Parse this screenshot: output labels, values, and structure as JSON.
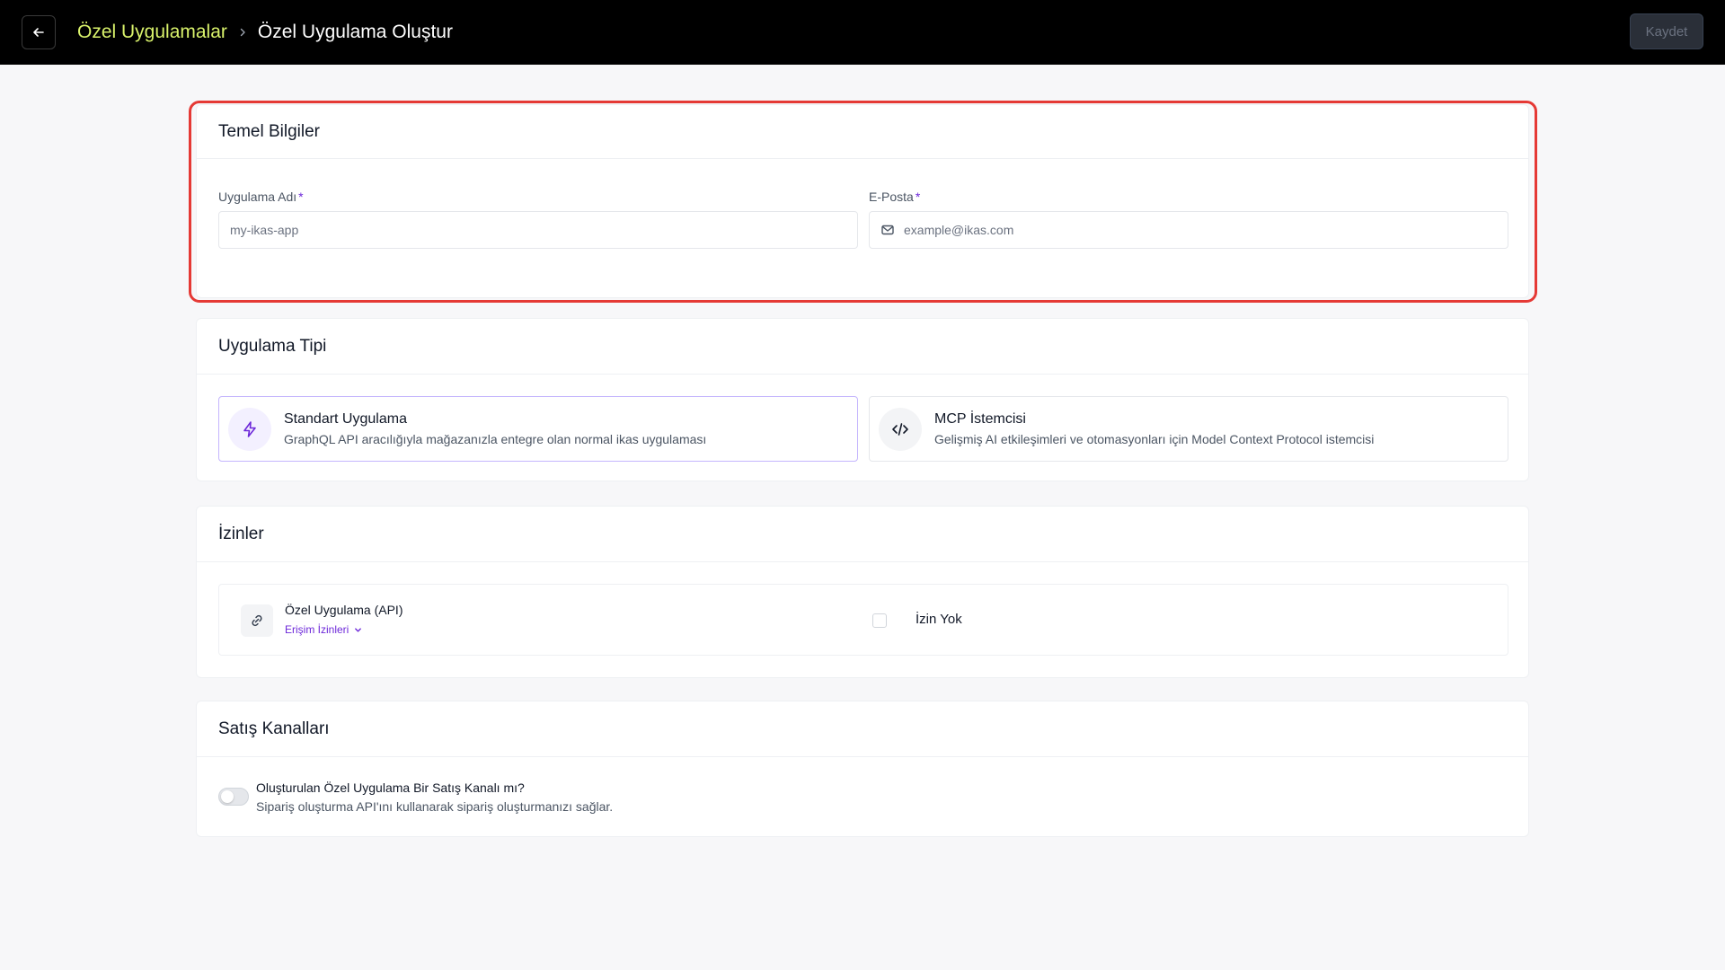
{
  "header": {
    "breadcrumb_parent": "Özel Uygulamalar",
    "breadcrumb_current": "Özel Uygulama Oluştur",
    "save_label": "Kaydet"
  },
  "basic_info": {
    "title": "Temel Bilgiler",
    "app_name_label": "Uygulama Adı",
    "app_name_placeholder": "my-ikas-app",
    "email_label": "E-Posta",
    "email_placeholder": "example@ikas.com",
    "required_mark": "*"
  },
  "app_type": {
    "title": "Uygulama Tipi",
    "options": [
      {
        "title": "Standart Uygulama",
        "description": "GraphQL API aracılığıyla mağazanızla entegre olan normal ikas uygulaması",
        "icon": "lightning-icon",
        "selected": true
      },
      {
        "title": "MCP İstemcisi",
        "description": "Gelişmiş AI etkileşimleri ve otomasyonları için Model Context Protocol istemcisi",
        "icon": "code-icon",
        "selected": false
      }
    ]
  },
  "permissions": {
    "title": "İzinler",
    "item_title": "Özel Uygulama (API)",
    "item_link": "Erişim İzinleri",
    "no_permission_label": "İzin Yok",
    "checked": false
  },
  "sales_channels": {
    "title": "Satış Kanalları",
    "toggle_title": "Oluşturulan Özel Uygulama Bir Satış Kanalı mı?",
    "toggle_description": "Sipariş oluşturma API'ını kullanarak sipariş oluşturmanızı sağlar.",
    "toggle_on": false
  },
  "colors": {
    "accent": "#6d28d9",
    "breadcrumb_link": "#d9f26b",
    "highlight_border": "#e53935"
  }
}
